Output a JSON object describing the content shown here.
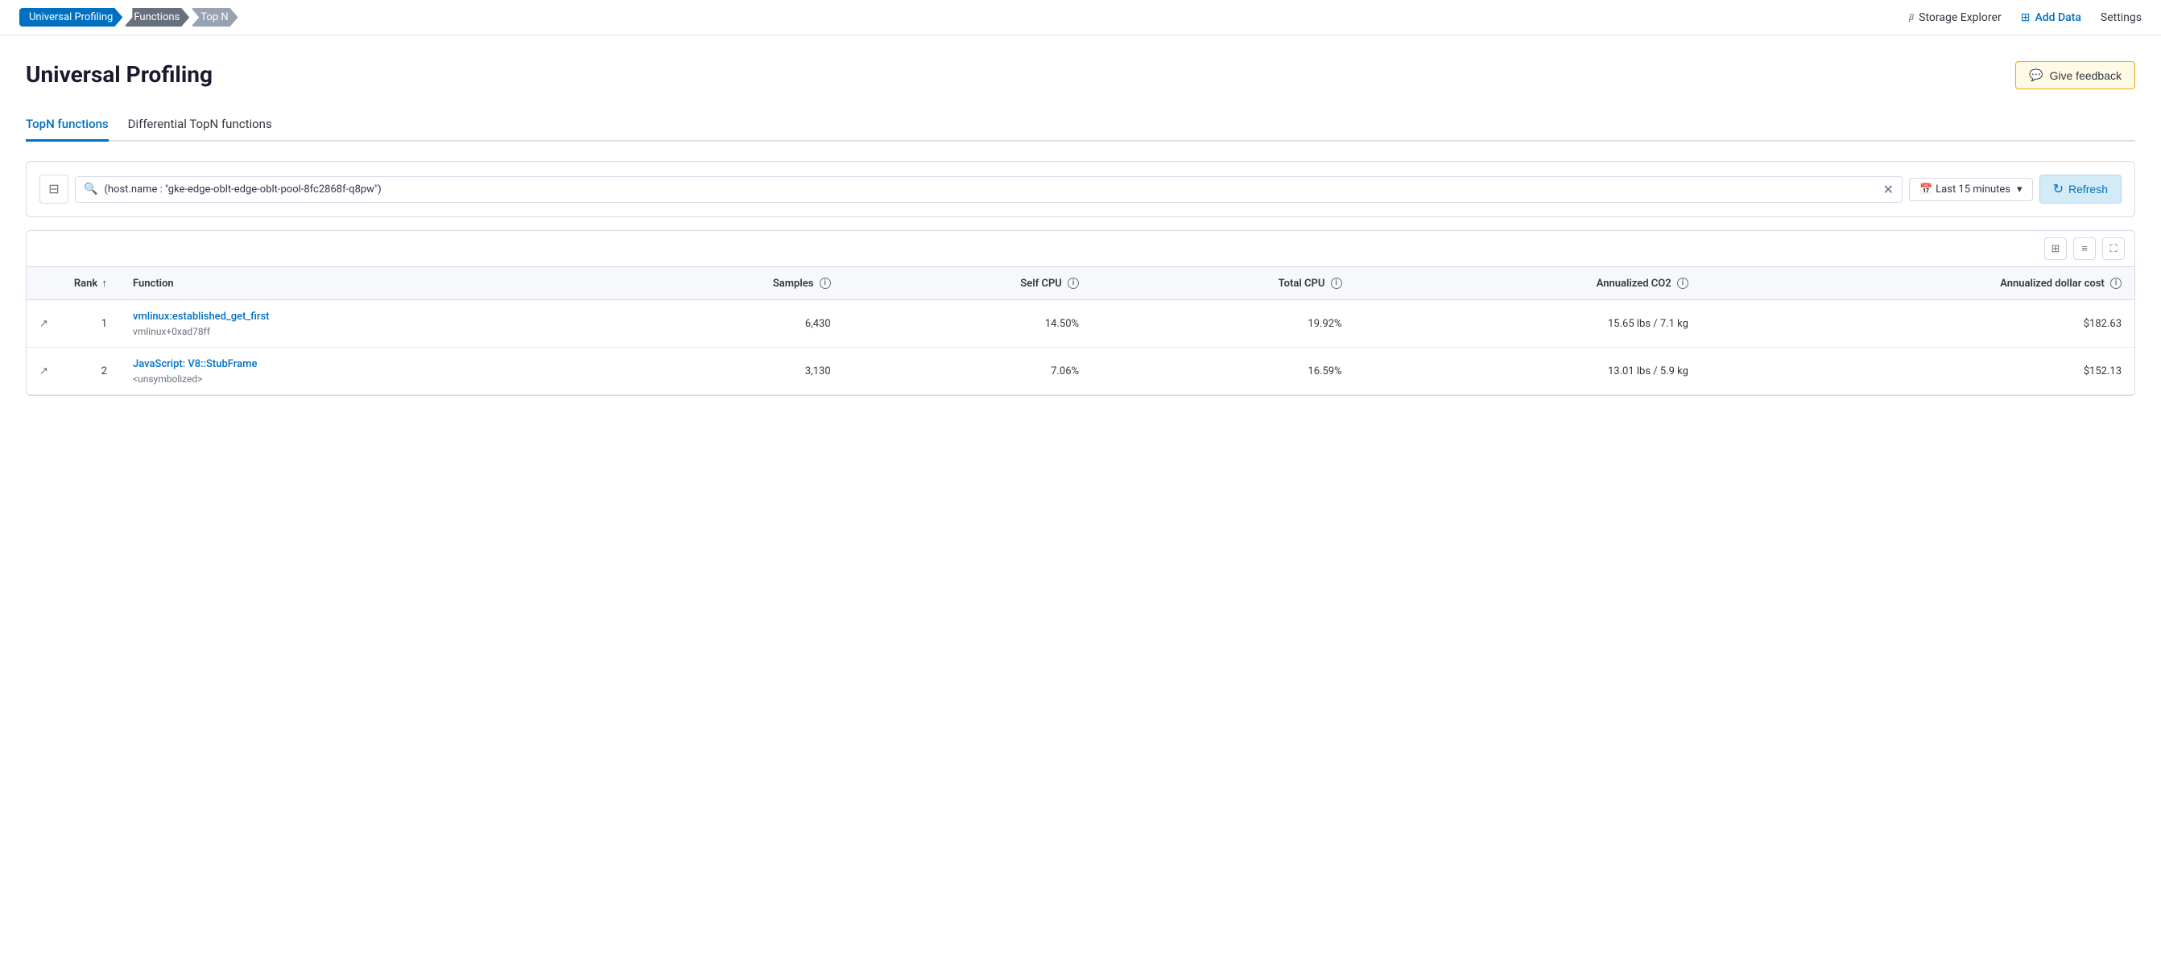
{
  "nav": {
    "breadcrumb": [
      {
        "label": "Universal Profiling",
        "state": "active"
      },
      {
        "label": "Functions",
        "state": "mid"
      },
      {
        "label": "Top N",
        "state": "last"
      }
    ],
    "right": [
      {
        "label": "Storage Explorer",
        "icon": "beta",
        "type": "storage"
      },
      {
        "label": "Add Data",
        "icon": "add",
        "type": "add"
      },
      {
        "label": "Settings",
        "icon": "",
        "type": "settings"
      }
    ]
  },
  "page": {
    "title": "Universal Profiling",
    "feedback_label": "Give feedback"
  },
  "tabs": [
    {
      "label": "TopN functions",
      "active": true
    },
    {
      "label": "Differential TopN functions",
      "active": false
    }
  ],
  "search": {
    "filter_icon": "⊟",
    "query": "(host.name : \"gke-edge-oblt-edge-oblt-pool-8fc2868f-q8pw\")",
    "time_label": "Last 15 minutes",
    "refresh_label": "Refresh"
  },
  "table": {
    "columns": [
      {
        "label": "",
        "key": "expand",
        "sortable": false
      },
      {
        "label": "Rank",
        "key": "rank",
        "sortable": true,
        "sort_dir": "asc"
      },
      {
        "label": "Function",
        "key": "function",
        "sortable": false
      },
      {
        "label": "Samples",
        "key": "samples",
        "sortable": false,
        "info": true
      },
      {
        "label": "Self CPU",
        "key": "self_cpu",
        "sortable": false,
        "info": true
      },
      {
        "label": "Total CPU",
        "key": "total_cpu",
        "sortable": false,
        "info": true
      },
      {
        "label": "Annualized CO2",
        "key": "co2",
        "sortable": false,
        "info": true
      },
      {
        "label": "Annualized dollar cost",
        "key": "dollar",
        "sortable": false,
        "info": true
      }
    ],
    "rows": [
      {
        "rank": 1,
        "function_name": "vmlinux:established_get_first",
        "function_sub": "vmlinux+0xad78ff",
        "samples": "6,430",
        "self_cpu": "14.50%",
        "total_cpu": "19.92%",
        "co2": "15.65 lbs / 7.1 kg",
        "dollar": "$182.63"
      },
      {
        "rank": 2,
        "function_name": "JavaScript: V8::StubFrame",
        "function_sub": "<unsymbolized>",
        "samples": "3,130",
        "self_cpu": "7.06%",
        "total_cpu": "16.59%",
        "co2": "13.01 lbs / 5.9 kg",
        "dollar": "$152.13"
      }
    ]
  },
  "icons": {
    "search": "🔍",
    "refresh": "↻",
    "feedback": "💬",
    "expand": "↗",
    "calendar": "📅",
    "columns": "⊞",
    "density": "≡",
    "fullscreen": "⛶"
  }
}
